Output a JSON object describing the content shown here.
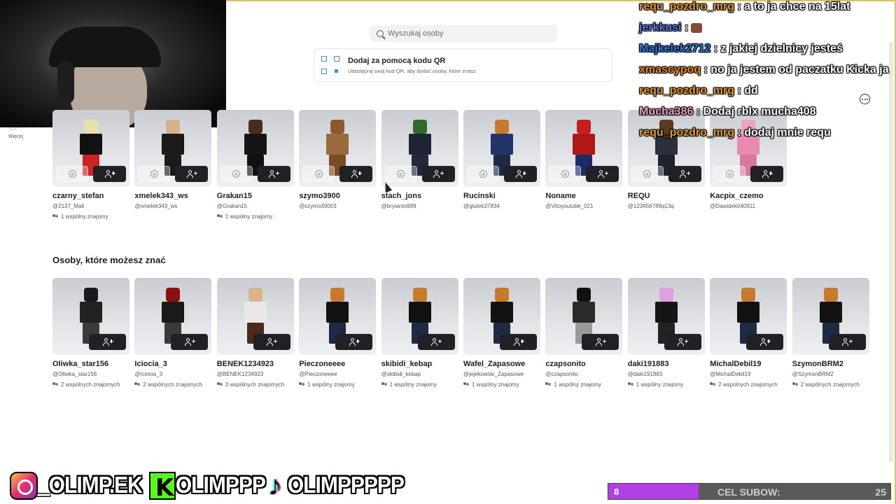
{
  "sidebar": {
    "more_label": "Więcej"
  },
  "search": {
    "placeholder": "Wyszukaj osoby"
  },
  "qr": {
    "title": "Dodaj za pomocą kodu QR",
    "subtitle": "Udostępnij swój kod QR, aby dodać osoby, które znasz"
  },
  "requests": [
    {
      "name": "czarny_stefan",
      "handle": "@2137_Mati",
      "mutual": "1 wspólny znajomy",
      "head": "#e8e0b0",
      "torso": "#111111",
      "legs": "#cc2222"
    },
    {
      "name": "xmelek343_ws",
      "handle": "@xmelek343_ws",
      "mutual": "",
      "head": "#d8b08a",
      "torso": "#1a1a1a",
      "legs": "#1a1a1a"
    },
    {
      "name": "Grakan15",
      "handle": "@Grakan15",
      "mutual": "1 wspólny znajomy",
      "head": "#4a2c1a",
      "torso": "#151515",
      "legs": "#101010"
    },
    {
      "name": "szymo3900",
      "handle": "@szymo39003",
      "mutual": "",
      "head": "#8a5a2c",
      "torso": "#9a6a3a",
      "legs": "#7a4a22"
    },
    {
      "name": "stach_jons",
      "handle": "@bryianto999",
      "mutual": "",
      "head": "#2e6a2a",
      "torso": "#1d2433",
      "legs": "#22293a"
    },
    {
      "name": "Rucinski",
      "handle": "@glutek37834",
      "mutual": "",
      "head": "#c87a2a",
      "torso": "#223366",
      "legs": "#1e2a44"
    },
    {
      "name": "Noname",
      "handle": "@Vitoyoutube_021",
      "mutual": "",
      "head": "#c81e1e",
      "torso": "#b01818",
      "legs": "#1c2a66"
    },
    {
      "name": "REQU",
      "handle": "@123456789q13q",
      "mutual": "",
      "head": "#5a3a22",
      "torso": "#2a2f3a",
      "legs": "#1e2230"
    },
    {
      "name": "Kacpix_czemo",
      "handle": "@Dawidek040911",
      "mutual": "",
      "head": "#f0a0c0",
      "torso": "#e88ab0",
      "legs": "#d878a0"
    }
  ],
  "suggested_title": "Osoby, które możesz znać",
  "suggested": [
    {
      "name": "Oliwka_star156",
      "handle": "@Oliwka_star156",
      "mutual": "2 wspólnych znajomych",
      "head": "#1a1a1a",
      "torso": "#222222",
      "legs": "#3a3a3a"
    },
    {
      "name": "Iciocia_3",
      "handle": "@Iciocia_3",
      "mutual": "2 wspólnych znajomych",
      "head": "#8a1010",
      "torso": "#1a1a1a",
      "legs": "#3a3a3a"
    },
    {
      "name": "BENEK1234923",
      "handle": "@BENEK1234923",
      "mutual": "3 wspólnych znajomych",
      "head": "#d9b48a",
      "torso": "#e8e8e8",
      "legs": "#4a2a1a"
    },
    {
      "name": "Pieczoneeee",
      "handle": "@Pieczoneeee",
      "mutual": "1 wspólny znajomy",
      "head": "#c87a2a",
      "torso": "#111111",
      "legs": "#1e2a44"
    },
    {
      "name": "skibidi_kebap",
      "handle": "@skibidi_kebap",
      "mutual": "1 wspólny znajomy",
      "head": "#c87a2a",
      "torso": "#111111",
      "legs": "#1e2a44"
    },
    {
      "name": "Wafel_Zapasowe",
      "handle": "@jejekowski_Zapasowe",
      "mutual": "1 wspólny znajomy",
      "head": "#c87a2a",
      "torso": "#111111",
      "legs": "#1e2a44"
    },
    {
      "name": "czapsonito",
      "handle": "@czapsonito",
      "mutual": "1 wspólny znajomy",
      "head": "#111111",
      "torso": "#2a2a2a",
      "legs": "#9a9a9a"
    },
    {
      "name": "daki191883",
      "handle": "@daki191883",
      "mutual": "1 wspólny znajomy",
      "head": "#e0a0e0",
      "torso": "#151515",
      "legs": "#222222"
    },
    {
      "name": "MichalDebil19",
      "handle": "@MichalDebil19",
      "mutual": "2 wspólnych znajomych",
      "head": "#c87a2a",
      "torso": "#111111",
      "legs": "#1e2a44"
    },
    {
      "name": "SzymonBRM2",
      "handle": "@SzymonBRM2",
      "mutual": "2 wspólnych znajomych",
      "head": "#c87a2a",
      "torso": "#111111",
      "legs": "#1e2a44"
    }
  ],
  "chat": [
    {
      "user": "requ_pozdro_mrg",
      "color": "#e39a2a",
      "text": ": a to ja chce na 15lat",
      "emote": false
    },
    {
      "user": "jerkkusi",
      "color": "#5a7adf",
      "text": ":",
      "emote": true
    },
    {
      "user": "Majkelek2712",
      "color": "#2a7ae0",
      "text": ": z jakiej dzielnicy jesteś",
      "emote": false
    },
    {
      "user": "xmascypoq",
      "color": "#e88a1a",
      "text": ": no ja jestem od paczatku Kicka ja",
      "emote": false
    },
    {
      "user": "requ_pozdro_mrg",
      "color": "#e39a2a",
      "text": ": dd",
      "emote": false
    },
    {
      "user": "Mucha386",
      "color": "#f0a0c8",
      "text": ": Dodaj rblx mucha408",
      "emote": false
    },
    {
      "user": "requ_pozdro_mrg",
      "color": "#e39a2a",
      "text": ": dodaj mnie requ",
      "emote": false
    }
  ],
  "socials": {
    "instagram": "_OLIMP.EK",
    "kick": "OLIMPPP",
    "tiktok": "OLIMPPPPP"
  },
  "goal": {
    "current": "8",
    "label": "CEL SUBOW:",
    "target": "25",
    "progress": 0.32
  }
}
